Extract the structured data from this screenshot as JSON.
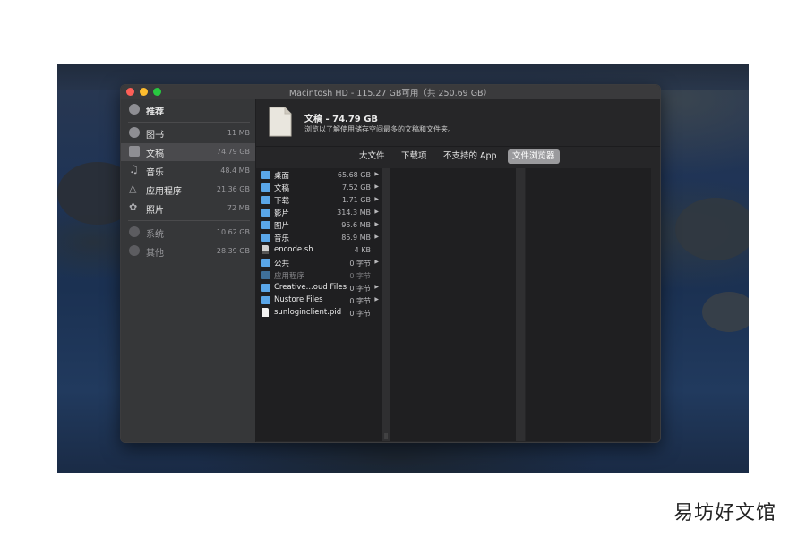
{
  "window": {
    "title": "Macintosh HD - 115.27 GB可用（共 250.69 GB）"
  },
  "sidebar": {
    "items": [
      {
        "label": "推荐",
        "size": "",
        "icon": "recommend-icon"
      },
      {
        "label": "图书",
        "size": "11 MB",
        "icon": "books-icon"
      },
      {
        "label": "文稿",
        "size": "74.79 GB",
        "icon": "documents-icon"
      },
      {
        "label": "音乐",
        "size": "48.4 MB",
        "icon": "music-icon"
      },
      {
        "label": "应用程序",
        "size": "21.36 GB",
        "icon": "applications-icon"
      },
      {
        "label": "照片",
        "size": "72 MB",
        "icon": "photos-icon"
      },
      {
        "label": "系统",
        "size": "10.62 GB",
        "icon": "system-icon"
      },
      {
        "label": "其他",
        "size": "28.39 GB",
        "icon": "other-icon"
      }
    ],
    "selected": "文稿"
  },
  "header": {
    "title": "文稿 - 74.79 GB",
    "subtitle": "浏览以了解使用储存空间最多的文稿和文件夹。"
  },
  "tabs": [
    {
      "label": "大文件"
    },
    {
      "label": "下载项"
    },
    {
      "label": "不支持的 App"
    },
    {
      "label": "文件浏览器"
    }
  ],
  "active_tab": "文件浏览器",
  "files": [
    {
      "name": "桌面",
      "size": "65.68 GB",
      "type": "folder",
      "arrow": true
    },
    {
      "name": "文稿",
      "size": "7.52 GB",
      "type": "folder",
      "arrow": true
    },
    {
      "name": "下载",
      "size": "1.71 GB",
      "type": "folder",
      "arrow": true
    },
    {
      "name": "影片",
      "size": "314.3 MB",
      "type": "folder",
      "arrow": true
    },
    {
      "name": "图片",
      "size": "95.6 MB",
      "type": "folder",
      "arrow": true
    },
    {
      "name": "音乐",
      "size": "85.9 MB",
      "type": "folder",
      "arrow": true
    },
    {
      "name": "encode.sh",
      "size": "4 KB",
      "type": "script",
      "arrow": false
    },
    {
      "name": "公共",
      "size": "0 字节",
      "type": "folder",
      "arrow": true
    },
    {
      "name": "应用程序",
      "size": "0 字节",
      "type": "folder-dim",
      "arrow": false
    },
    {
      "name": "Creative...oud Files",
      "size": "0 字节",
      "type": "folder",
      "arrow": true
    },
    {
      "name": "Nustore Files",
      "size": "0 字节",
      "type": "folder",
      "arrow": true
    },
    {
      "name": "sunloginclient.pid",
      "size": "0 字节",
      "type": "file",
      "arrow": false
    }
  ],
  "watermark": "易坊好文馆",
  "colors": {
    "window_bg": "#252527",
    "sidebar_bg": "#363739",
    "folder_blue": "#5aa6e8",
    "tab_active": "#9a9a9d"
  }
}
